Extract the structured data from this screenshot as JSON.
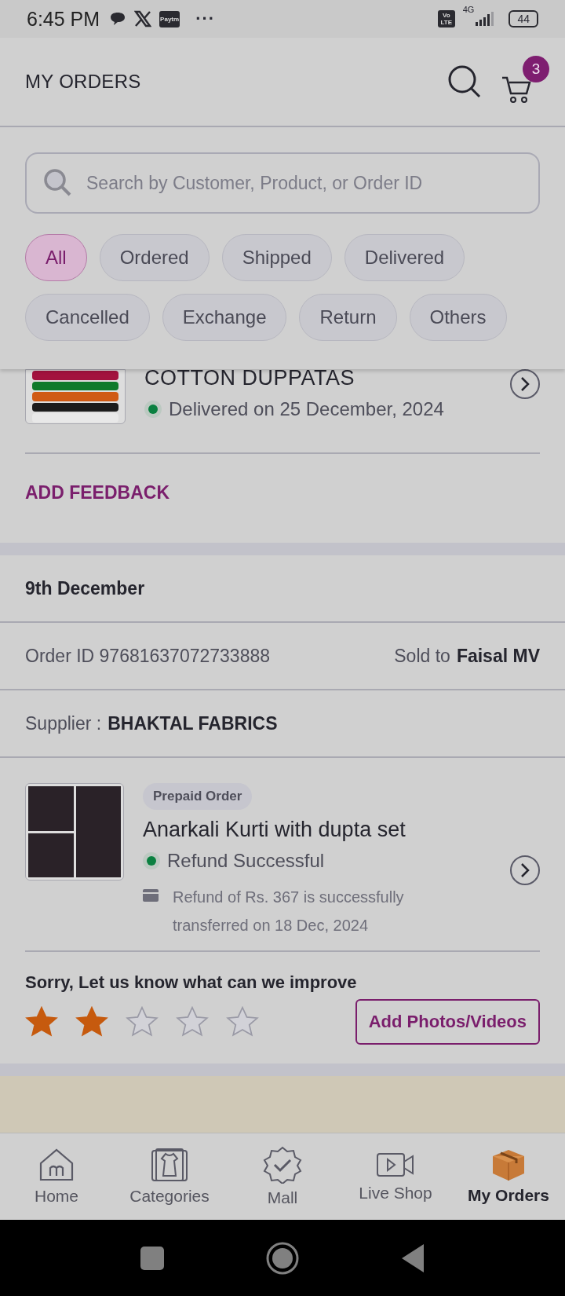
{
  "status_bar": {
    "time": "6:45 PM",
    "paytm": "Paytm",
    "more": "···",
    "volte": "Vo LTE",
    "network": "4G",
    "battery": "44"
  },
  "header": {
    "title": "MY ORDERS",
    "cart_count": "3"
  },
  "search": {
    "placeholder": "Search by Customer, Product, or Order ID"
  },
  "filters": [
    {
      "label": "All",
      "selected": true
    },
    {
      "label": "Ordered",
      "selected": false
    },
    {
      "label": "Shipped",
      "selected": false
    },
    {
      "label": "Delivered",
      "selected": false
    },
    {
      "label": "Cancelled",
      "selected": false
    },
    {
      "label": "Exchange",
      "selected": false
    },
    {
      "label": "Return",
      "selected": false
    },
    {
      "label": "Others",
      "selected": false
    }
  ],
  "orders": [
    {
      "product": "COTTON DUPPATAS",
      "status": "Delivered on 25 December, 2024",
      "feedback_link": "ADD FEEDBACK"
    },
    {
      "date": "9th December",
      "order_id": "Order ID 97681637072733888",
      "sold_to_label": "Sold to",
      "sold_to": "Faisal MV",
      "supplier_label": "Supplier :",
      "supplier": "BHAKTAL FABRICS",
      "tag": "Prepaid Order",
      "product": "Anarkali Kurti with dupta set",
      "status": "Refund Successful",
      "refund_note": "Refund of Rs. 367 is successfully transferred on 18 Dec, 2024",
      "feedback_prompt": "Sorry, Let us know what can we improve",
      "stars": 2,
      "media_button": "Add Photos/Videos"
    }
  ],
  "bottom_nav": [
    {
      "kind": "home",
      "label": "Home",
      "selected": false
    },
    {
      "kind": "categories",
      "label": "Categories",
      "selected": false
    },
    {
      "kind": "mall",
      "label": "Mall",
      "selected": false
    },
    {
      "kind": "live",
      "label": "Live Shop",
      "selected": false
    },
    {
      "kind": "orders",
      "label": "My Orders",
      "selected": true
    }
  ]
}
